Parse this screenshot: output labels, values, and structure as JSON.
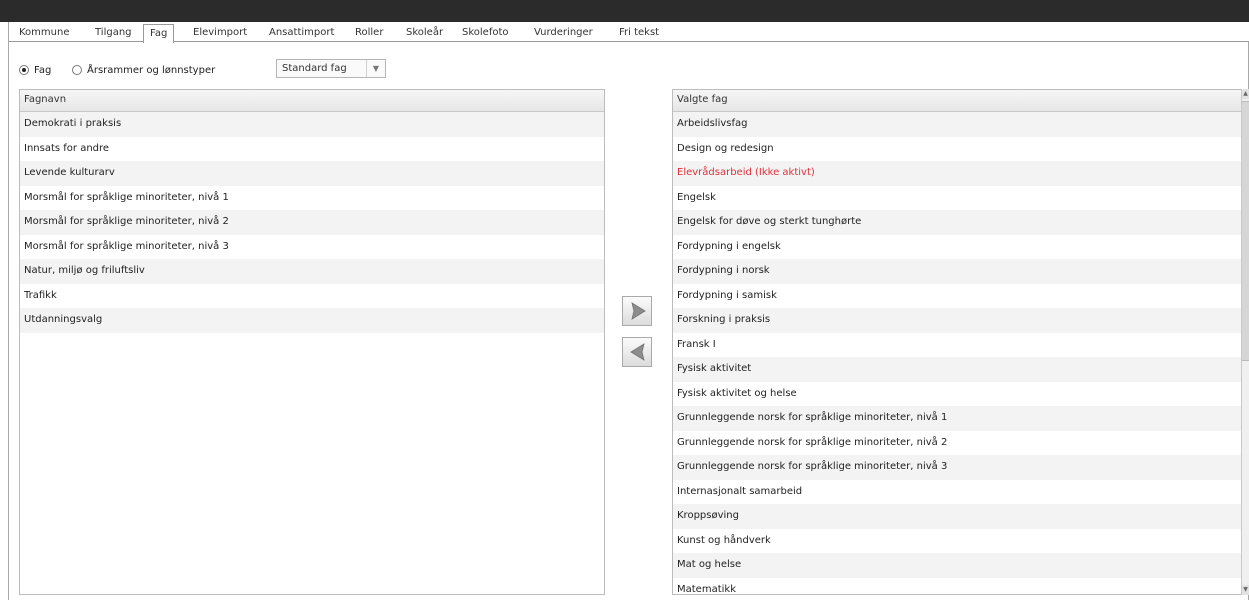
{
  "tabs": [
    {
      "label": "Kommune",
      "active": false
    },
    {
      "label": "Tilgang",
      "active": false
    },
    {
      "label": "Fag",
      "active": true
    },
    {
      "label": "Elevimport",
      "active": false
    },
    {
      "label": "Ansattimport",
      "active": false
    },
    {
      "label": "Roller",
      "active": false
    },
    {
      "label": "Skoleår",
      "active": false
    },
    {
      "label": "Skolefoto",
      "active": false
    },
    {
      "label": "Vurderinger",
      "active": false
    },
    {
      "label": "Fri tekst",
      "active": false
    }
  ],
  "options": {
    "radio_fag": "Fag",
    "radio_arsrammer": "Årsrammer og lønnstyper",
    "selected_radio": "Fag",
    "select_value": "Standard fag"
  },
  "left_list": {
    "header": "Fagnavn",
    "items": [
      "Demokrati i praksis",
      "Innsats for andre",
      "Levende kulturarv",
      "Morsmål for språklige minoriteter, nivå 1",
      "Morsmål for språklige minoriteter, nivå 2",
      "Morsmål for språklige minoriteter, nivå 3",
      "Natur, miljø og friluftsliv",
      "Trafikk",
      "Utdanningsvalg"
    ]
  },
  "right_list": {
    "header": "Valgte fag",
    "inactive_color": "#e0313a",
    "items": [
      {
        "label": "Arbeidslivsfag",
        "inactive": false
      },
      {
        "label": "Design og redesign",
        "inactive": false
      },
      {
        "label": "Elevrådsarbeid (Ikke aktivt)",
        "inactive": true
      },
      {
        "label": "Engelsk",
        "inactive": false
      },
      {
        "label": "Engelsk for døve og sterkt tunghørte",
        "inactive": false
      },
      {
        "label": "Fordypning i engelsk",
        "inactive": false
      },
      {
        "label": "Fordypning i norsk",
        "inactive": false
      },
      {
        "label": "Fordypning i samisk",
        "inactive": false
      },
      {
        "label": "Forskning i praksis",
        "inactive": false
      },
      {
        "label": "Fransk I",
        "inactive": false
      },
      {
        "label": "Fysisk aktivitet",
        "inactive": false
      },
      {
        "label": "Fysisk aktivitet og helse",
        "inactive": false
      },
      {
        "label": "Grunnleggende norsk for språklige minoriteter, nivå 1",
        "inactive": false
      },
      {
        "label": "Grunnleggende norsk for språklige minoriteter, nivå 2",
        "inactive": false
      },
      {
        "label": "Grunnleggende norsk for språklige minoriteter, nivå 3",
        "inactive": false
      },
      {
        "label": "Internasjonalt samarbeid",
        "inactive": false
      },
      {
        "label": "Kroppsøving",
        "inactive": false
      },
      {
        "label": "Kunst og håndverk",
        "inactive": false
      },
      {
        "label": "Mat og helse",
        "inactive": false
      },
      {
        "label": "Matematikk",
        "inactive": false
      }
    ]
  },
  "buttons": {
    "move_right_icon": "chevron-right-icon",
    "move_left_icon": "chevron-left-icon"
  }
}
